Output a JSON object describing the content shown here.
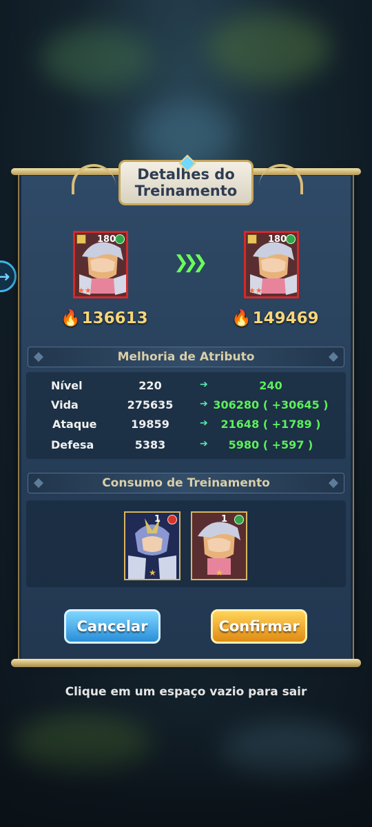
{
  "dialog": {
    "title": "Detalhes do\nTreinamento",
    "side_arrow_icon": "arrow-right-circle-icon"
  },
  "hero_before": {
    "level": "180",
    "power": "136613",
    "stars": "★★"
  },
  "hero_after": {
    "level": "180",
    "power": "149469",
    "stars": "★★"
  },
  "attribute_section": {
    "title": "Melhoria de Atributo",
    "rows": [
      {
        "label": "Nível",
        "current": "220",
        "next": "240"
      },
      {
        "label": "Vida",
        "current": "275635",
        "next": "306280 ( +30645 )"
      },
      {
        "label": "Ataque",
        "current": "19859",
        "next": "21648 ( +1789 )"
      },
      {
        "label": "Defesa",
        "current": "5383",
        "next": "5980 ( +597 )"
      }
    ]
  },
  "consumption_section": {
    "title": "Consumo de Treinamento",
    "materials": [
      {
        "count": "1",
        "element": "fire",
        "element_color": "#d8332a"
      },
      {
        "count": "1",
        "element": "wind",
        "element_color": "#2fa64a"
      }
    ]
  },
  "buttons": {
    "cancel": "Cancelar",
    "confirm": "Confirmar"
  },
  "hint": "Clique em um espaço vazio para sair",
  "colors": {
    "increase_green": "#5cf05a",
    "power_gold": "#f6d57b",
    "cancel_blue": "#2a8fd9",
    "confirm_orange": "#e08b14"
  }
}
